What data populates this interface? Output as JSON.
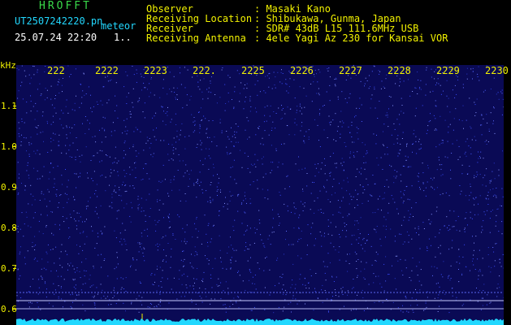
{
  "header": {
    "app_name": "HROFFT",
    "filename": "UT2507242220.pn",
    "event_type": "meteor",
    "datetime": "25.07.24 22:20",
    "count": "1..",
    "observer_label": "Observer",
    "observer_value": ": Masaki Kano",
    "location_label": "Receiving Location",
    "location_value": ": Shibukawa, Gunma, Japan",
    "receiver_label": "Receiver",
    "receiver_value": ": SDR# 43dB L15 111.6MHz USB",
    "antenna_label": "Receiving Antenna",
    "antenna_value": ": 4ele Yagi Az 230 for Kansai VOR"
  },
  "axes": {
    "y_unit": "kHz",
    "y_ticks": [
      "1.1",
      "1.0",
      "0.9",
      "0.8",
      "0.7",
      "0.6"
    ],
    "x_ticks": [
      "222",
      "2222",
      "2223",
      "222.",
      "2225",
      "2226",
      "2227",
      "2228",
      "2229",
      "2230"
    ]
  },
  "colors": {
    "background": "#000000",
    "spectrogram": "#0a0a55",
    "noise_dots": "#4a5cff",
    "signal_line": "#c8ccff",
    "baseline": "#22d8ff",
    "axis_text": "#f2f200"
  }
}
